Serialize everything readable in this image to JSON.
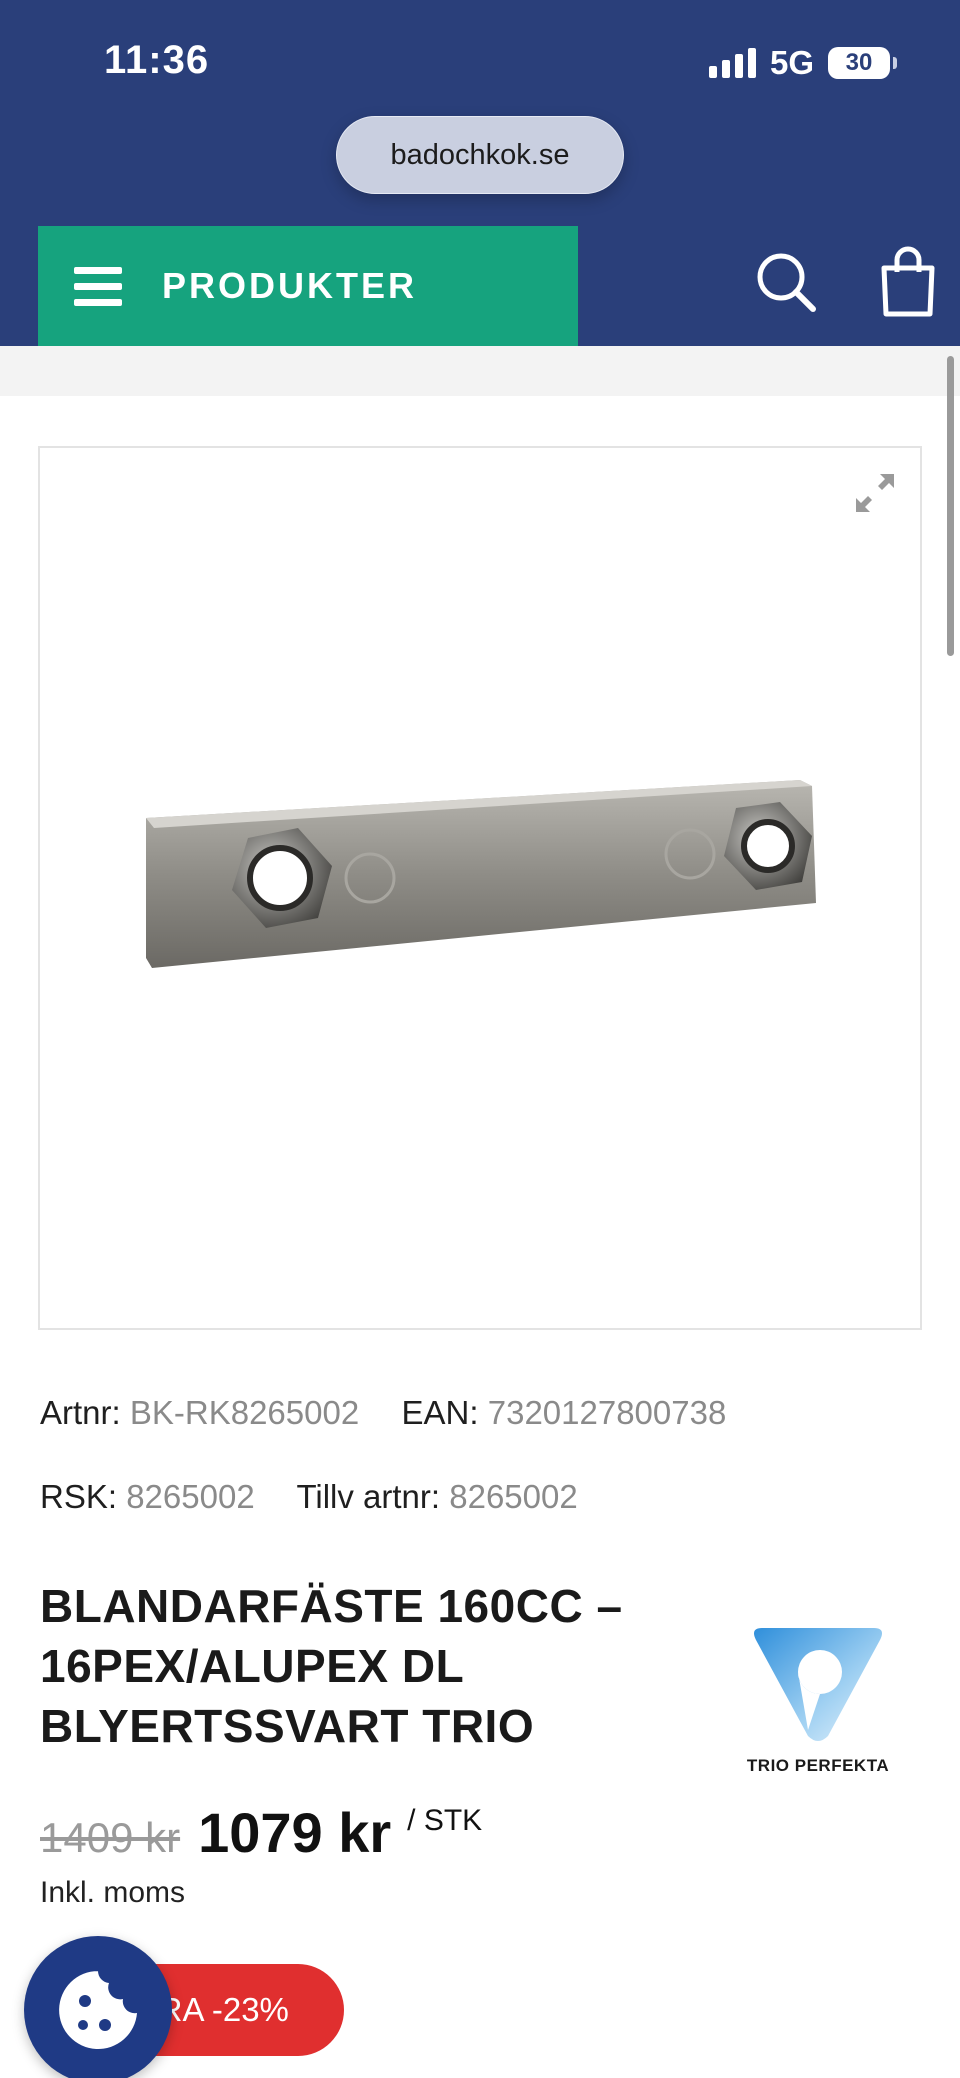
{
  "status_bar": {
    "time": "11:36",
    "network": "5G",
    "battery": "30"
  },
  "browser": {
    "url": "badochkok.se"
  },
  "header": {
    "menu_label": "PRODUKTER",
    "icons": [
      "search-icon",
      "shopping-bag-icon"
    ]
  },
  "product": {
    "meta": {
      "artnr_label": "Artnr:",
      "artnr": "BK-RK8265002",
      "ean_label": "EAN:",
      "ean": "7320127800738",
      "rsk_label": "RSK:",
      "rsk": "8265002",
      "tillv_label": "Tillv artnr:",
      "tillv": "8265002"
    },
    "title_lines": [
      "BLANDARFÄSTE 160CC –",
      "16PEX/ALUPEX DL",
      "BLYERTSSVART TRIO"
    ],
    "brand": "TRIO PERFEKTA",
    "old_price": "1409 kr",
    "price": "1079 kr",
    "unit": "/ STK",
    "vat_note": "Inkl. moms",
    "sale_badge": "SPARA -23%"
  },
  "colors": {
    "header_bg": "#2a3f7a",
    "menu_green": "#16a37e",
    "sale_red": "#e02f2f",
    "cookie_blue": "#1f3a85"
  }
}
